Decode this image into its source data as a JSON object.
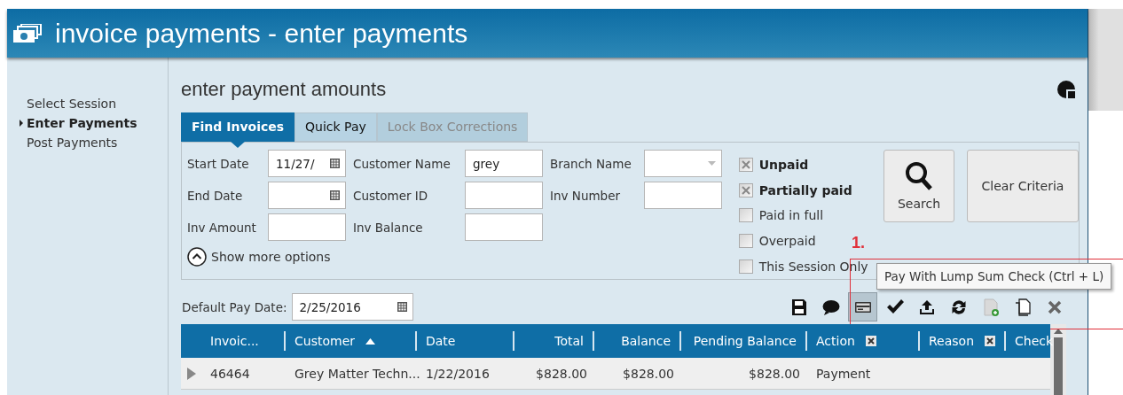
{
  "window": {
    "title": "invoice payments - enter payments"
  },
  "sidebar": {
    "items": [
      {
        "label": "Select Session",
        "selected": false
      },
      {
        "label": "Enter Payments",
        "selected": true
      },
      {
        "label": "Post Payments",
        "selected": false
      }
    ]
  },
  "heading": "enter payment amounts",
  "tabs": [
    {
      "label": "Find Invoices",
      "selected": true,
      "disabled": false
    },
    {
      "label": "Quick Pay",
      "selected": false,
      "disabled": false
    },
    {
      "label": "Lock Box Corrections",
      "selected": false,
      "disabled": true
    }
  ],
  "filters": {
    "fields": [
      {
        "label": "Start Date",
        "kind": "date",
        "value": "11/27/"
      },
      {
        "label": "Customer Name",
        "kind": "text",
        "value": "grey"
      },
      {
        "label": "Branch Name",
        "kind": "select"
      },
      {
        "label": "End Date",
        "kind": "date"
      },
      {
        "label": "Customer ID",
        "kind": "text"
      },
      {
        "label": "Inv Number",
        "kind": "text"
      },
      {
        "label": "Inv Amount",
        "kind": "text"
      },
      {
        "label": "Inv Balance",
        "kind": "text"
      }
    ],
    "show_more": "Show more options",
    "statuses": [
      {
        "label": "Unpaid",
        "checked": true
      },
      {
        "label": "Partially paid",
        "checked": true
      },
      {
        "label": "Paid in full",
        "checked": false
      },
      {
        "label": "Overpaid",
        "checked": false
      },
      {
        "label": "This Session Only",
        "checked": false
      }
    ],
    "search_button": "Search",
    "clear_button": "Clear Criteria"
  },
  "annotation": {
    "label": "1.",
    "tooltip": "Pay With Lump Sum Check (Ctrl + L)"
  },
  "default_pay_date": {
    "label": "Default Pay Date:",
    "value": "2/25/2016"
  },
  "toolbar": [
    {
      "kind": "save",
      "pressed": false
    },
    {
      "kind": "comment",
      "pressed": false
    },
    {
      "kind": "card",
      "pressed": true
    },
    {
      "kind": "check",
      "pressed": false
    },
    {
      "kind": "upload",
      "pressed": false
    },
    {
      "kind": "refresh",
      "pressed": false
    },
    {
      "kind": "add-document",
      "pressed": false
    },
    {
      "kind": "copy",
      "pressed": false
    },
    {
      "kind": "delete",
      "pressed": false
    }
  ],
  "table": {
    "columns": [
      {
        "label": "Invoic...",
        "sorted": false,
        "clearable": false
      },
      {
        "label": "Customer",
        "sorted": true,
        "clearable": false
      },
      {
        "label": "Date",
        "sorted": false,
        "clearable": false
      },
      {
        "label": "Total",
        "sorted": false,
        "clearable": false
      },
      {
        "label": "Balance",
        "sorted": false,
        "clearable": false
      },
      {
        "label": "Pending Balance",
        "sorted": false,
        "clearable": false
      },
      {
        "label": "Action",
        "sorted": false,
        "clearable": true
      },
      {
        "label": "Reason",
        "sorted": false,
        "clearable": true
      },
      {
        "label": "Check",
        "sorted": false,
        "clearable": false
      }
    ],
    "rows": [
      {
        "expanded": false,
        "cells": [
          "46464",
          "Grey Matter Techn...",
          "1/22/2016",
          "$828.00",
          "$828.00",
          "$828.00",
          "Payment"
        ]
      }
    ]
  }
}
